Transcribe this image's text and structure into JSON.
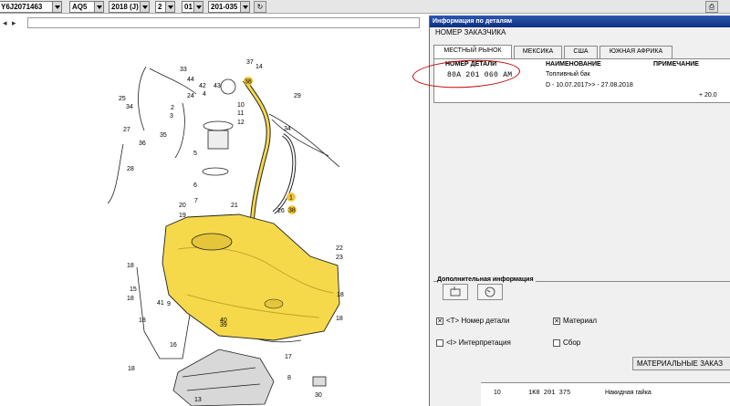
{
  "toolbar": {
    "vin": "Y6J2071463",
    "model": "AQ5",
    "year": "2018 (J)",
    "field4": "2",
    "field5": "01",
    "field6": "201-035"
  },
  "diagram": {
    "callouts": [
      "33",
      "27",
      "37",
      "14",
      "2",
      "44",
      "42",
      "43",
      "24",
      "4",
      "38",
      "25",
      "34",
      "3",
      "10",
      "11",
      "29",
      "34",
      "12",
      "27",
      "35",
      "36",
      "5",
      "28",
      "6",
      "7",
      "20",
      "19",
      "21",
      "1",
      "26",
      "38",
      "22",
      "23",
      "18",
      "15",
      "41",
      "9",
      "18",
      "40",
      "39",
      "16",
      "18",
      "18",
      "17",
      "8",
      "13",
      "30"
    ]
  },
  "details": {
    "title": "Информация по деталям",
    "customer_label": "НОМЕР ЗАКАЗЧИКА",
    "tabs": [
      "МЕСТНЫЙ РЫНОК",
      "МЕКСИКА",
      "США",
      "ЮЖНАЯ АФРИКА"
    ],
    "headers": {
      "part_no": "НОМЕР ДЕТАЛИ",
      "name": "НАИМЕНОВАНИЕ",
      "note": "ПРИМЕЧАНИЕ"
    },
    "row": {
      "part_no": "80A 201 060 AM",
      "name": "Топливный бак",
      "period": "D - 10.07.2017>> - 27.08.2018",
      "extra": "+ 20.0"
    },
    "add_info_label": "Дополнительная информация",
    "checkboxes": [
      {
        "label": "<T> Номер детали",
        "checked": true
      },
      {
        "label": "Материал",
        "checked": true
      },
      {
        "label": "<I> Интерпретация",
        "checked": false
      },
      {
        "label": "Сбор",
        "checked": false
      }
    ],
    "material_button": "МАТЕРИАЛЬНЫЕ ЗАКАЗ",
    "bottom_row": {
      "pos": "10",
      "part_no": "1K0 201 375",
      "name": "Накидная гайка"
    }
  },
  "colors": {
    "tank": "#f5d94a",
    "title_bar": "#1c48a0",
    "highlight_circle": "#c40000",
    "callout_highlight": "#f3c63a"
  }
}
